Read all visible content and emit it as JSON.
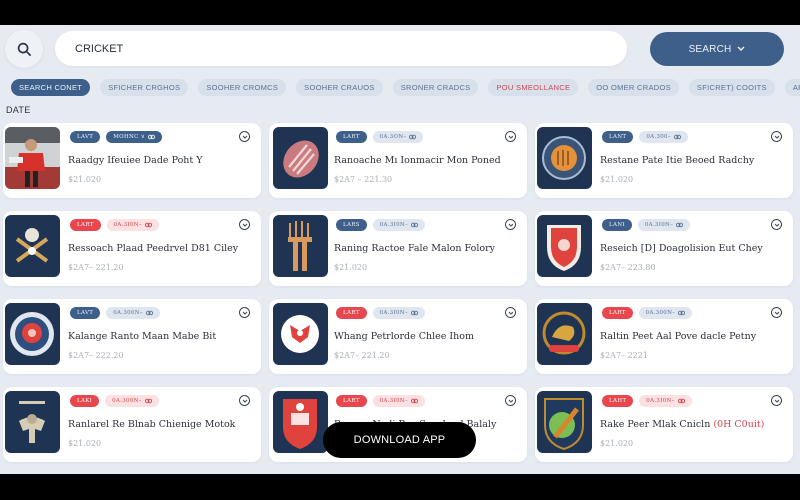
{
  "search": {
    "value": "CRICKET",
    "button_label": "SEARCH",
    "icon": "search-icon",
    "button_icon": "chevron-down-icon"
  },
  "filters": [
    {
      "label": "SEARCH CONET",
      "active": true
    },
    {
      "label": "SFICHER CRGHOS"
    },
    {
      "label": "SOOHER CROMCS"
    },
    {
      "label": "SOOHER CRAUOS"
    },
    {
      "label": "SRONER CRADCS"
    },
    {
      "label": "POU SMEOLLANCE",
      "highlight": true
    },
    {
      "label": "OO OMER CRADOS"
    },
    {
      "label": "SFICRET) COOITS"
    },
    {
      "label": "APUCT"
    }
  ],
  "section_label": "DATE",
  "cards": [
    {
      "tag": "LAVT",
      "tag_color": "blue",
      "sub": "MOHNC ∨",
      "sub_icon": "link-icon",
      "sub_style": "dark-blue",
      "title": "Raadgy Ifeuiee Dade Poht Y",
      "price": "$21.020",
      "image": "player-photo"
    },
    {
      "tag": "LART",
      "tag_color": "blue",
      "sub": "0A.3ON–",
      "sub_icon": "crest-icon",
      "sub_style": "soft-blue",
      "title": "Ranoache Mı Ionmacir Mon Poned",
      "price": "$2A7 – 221.30",
      "image": "cricket-ball"
    },
    {
      "tag": "LANT",
      "tag_color": "blue",
      "sub": "0A.300–",
      "sub_icon": "crest-icon",
      "sub_style": "soft-blue",
      "title": "Restane Pate Itie Beoed Radchy",
      "price": "$21.020",
      "image": "badge-emblem"
    },
    {
      "tag": "LART",
      "tag_color": "red",
      "sub": "0A.3I0N–",
      "sub_icon": "crest-icon",
      "sub_style": "soft-red",
      "title": "Ressoach Plaad Peedrvel D81 Ciley",
      "price": "$2A7– 221.20",
      "image": "crossed-bats-crest"
    },
    {
      "tag": "LARS",
      "tag_color": "blue",
      "sub": "0A.3I0N–",
      "sub_icon": "crest-icon",
      "sub_style": "soft-blue",
      "title": "Raning Ractoe Fale Malon Folory",
      "price": "$21.020",
      "image": "crown-pillar"
    },
    {
      "tag": "LANI",
      "tag_color": "blue",
      "sub": "0A.3I0N–",
      "sub_icon": "crest-icon",
      "sub_style": "soft-blue",
      "title": "Reseich [D] Doagolision Eut Chey",
      "price": "$2A7– 223.80",
      "image": "red-shield"
    },
    {
      "tag": "LAVT",
      "tag_color": "blue",
      "sub": "0A.300N–",
      "sub_icon": "crest-icon",
      "sub_style": "soft-blue",
      "title": "Kalange Ranto Maan Mabe Bit",
      "price": "$2A7– 222.20",
      "image": "round-badge"
    },
    {
      "tag": "LART",
      "tag_color": "red",
      "sub": "0A.3I0N–",
      "sub_icon": "crest-icon",
      "sub_style": "soft-blue",
      "title": "Whang Petrlorde Chlee Ihom",
      "price": "$2A7– 221.20",
      "image": "red-circle-emblem"
    },
    {
      "tag": "LART",
      "tag_color": "red",
      "sub": "0A.300N–",
      "sub_icon": "crest-icon",
      "sub_style": "soft-blue",
      "title": "Raltin Peet Aal Pove dacle Petny",
      "price": "$2A7– 2221",
      "image": "lion-wreath"
    },
    {
      "tag": "LAKI",
      "tag_color": "red",
      "sub": "0A.300N–",
      "sub_icon": "crest-icon",
      "sub_style": "soft-red",
      "title": "Ranlarel Re Blnab Chienige Motok",
      "price": "$21.020",
      "image": "elephant-crest"
    },
    {
      "tag": "LART",
      "tag_color": "red",
      "sub": "0A.3I0N–",
      "sub_icon": "crest-icon",
      "sub_style": "soft-red",
      "title": "Rnnaro Nadi Bec Sovaha d Balaly",
      "price": "",
      "image": "red-crest"
    },
    {
      "tag": "LAHT",
      "tag_color": "red",
      "sub": "0A.3I0N–",
      "sub_icon": "crest-icon",
      "sub_style": "soft-red",
      "title": "Rake Peer Mlak Cnicln",
      "title_accent": "(0H C0uit)",
      "price": "$21.020",
      "image": "green-shield"
    }
  ],
  "download_button": "DOWNLOAD APP"
}
